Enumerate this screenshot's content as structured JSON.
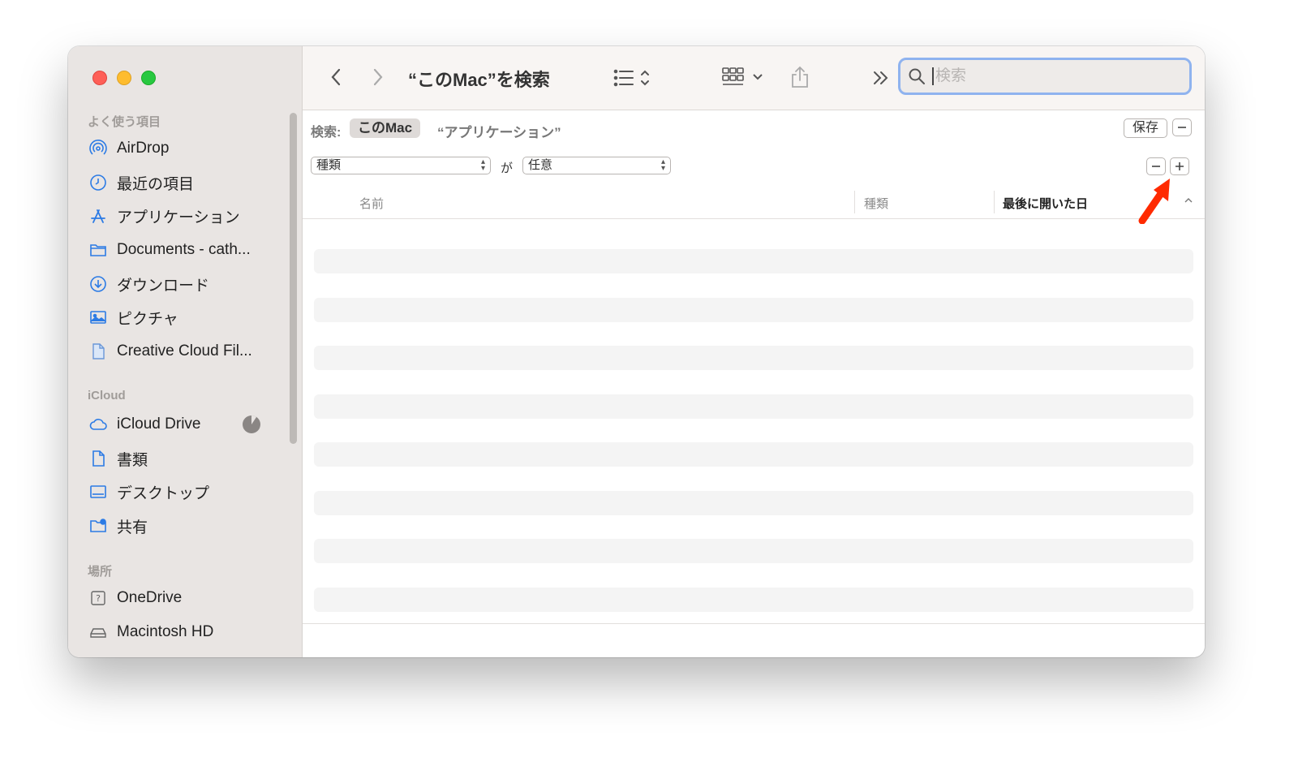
{
  "window": {
    "title": "“このMac”を検索"
  },
  "sidebar": {
    "sections": [
      {
        "label": "よく使う項目",
        "items": [
          {
            "label": "AirDrop",
            "icon": "airdrop-icon"
          },
          {
            "label": "最近の項目",
            "icon": "clock-icon"
          },
          {
            "label": "アプリケーション",
            "icon": "applications-icon"
          },
          {
            "label": "Documents - cath...",
            "icon": "folder-icon"
          },
          {
            "label": "ダウンロード",
            "icon": "download-icon"
          },
          {
            "label": "ピクチャ",
            "icon": "pictures-icon"
          },
          {
            "label": "Creative Cloud Fil...",
            "icon": "document-icon"
          }
        ]
      },
      {
        "label": "iCloud",
        "items": [
          {
            "label": "iCloud Drive",
            "icon": "cloud-icon"
          },
          {
            "label": "書類",
            "icon": "document-icon"
          },
          {
            "label": "デスクトップ",
            "icon": "desktop-icon"
          },
          {
            "label": "共有",
            "icon": "shared-folder-icon"
          }
        ]
      },
      {
        "label": "場所",
        "items": [
          {
            "label": "OneDrive",
            "icon": "question-drive-icon"
          },
          {
            "label": "Macintosh HD",
            "icon": "harddisk-icon"
          }
        ]
      }
    ]
  },
  "toolbar": {
    "search_placeholder": "検索"
  },
  "scope": {
    "label": "検索:",
    "active": "このMac",
    "other": "“アプリケーション”",
    "save": "保存"
  },
  "criteria": {
    "attribute": "種類",
    "connector": "が",
    "value": "任意"
  },
  "columns": {
    "name": "名前",
    "kind": "種類",
    "date": "最後に開いた日"
  },
  "colors": {
    "accent": "#2c7be5",
    "annotation_arrow": "#ff2a00",
    "sidebar_bg": "#e9e5e3"
  }
}
